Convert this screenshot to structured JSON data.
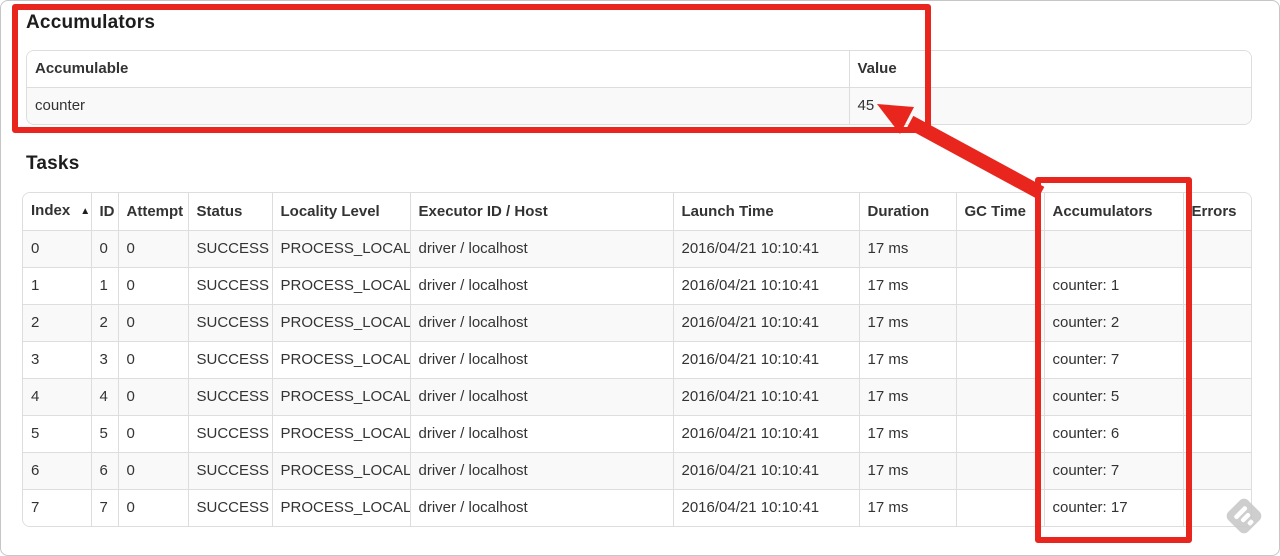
{
  "annotation": {
    "color": "#e8261d",
    "boxes": [
      "accumulators-summary",
      "accumulators-column"
    ],
    "arrow_target_value": "45"
  },
  "accumulators_section": {
    "title": "Accumulators",
    "table": {
      "headers": [
        "Accumulable",
        "Value"
      ],
      "rows": [
        [
          "counter",
          "45"
        ]
      ]
    }
  },
  "tasks_section": {
    "title": "Tasks",
    "table": {
      "headers": [
        "Index",
        "ID",
        "Attempt",
        "Status",
        "Locality Level",
        "Executor ID / Host",
        "Launch Time",
        "Duration",
        "GC Time",
        "Accumulators",
        "Errors"
      ],
      "sorted_column": "Index",
      "sort_icon": "▲",
      "rows": [
        [
          "0",
          "0",
          "0",
          "SUCCESS",
          "PROCESS_LOCAL",
          "driver / localhost",
          "2016/04/21 10:10:41",
          "17 ms",
          "",
          "",
          ""
        ],
        [
          "1",
          "1",
          "0",
          "SUCCESS",
          "PROCESS_LOCAL",
          "driver / localhost",
          "2016/04/21 10:10:41",
          "17 ms",
          "",
          "counter: 1",
          ""
        ],
        [
          "2",
          "2",
          "0",
          "SUCCESS",
          "PROCESS_LOCAL",
          "driver / localhost",
          "2016/04/21 10:10:41",
          "17 ms",
          "",
          "counter: 2",
          ""
        ],
        [
          "3",
          "3",
          "0",
          "SUCCESS",
          "PROCESS_LOCAL",
          "driver / localhost",
          "2016/04/21 10:10:41",
          "17 ms",
          "",
          "counter: 7",
          ""
        ],
        [
          "4",
          "4",
          "0",
          "SUCCESS",
          "PROCESS_LOCAL",
          "driver / localhost",
          "2016/04/21 10:10:41",
          "17 ms",
          "",
          "counter: 5",
          ""
        ],
        [
          "5",
          "5",
          "0",
          "SUCCESS",
          "PROCESS_LOCAL",
          "driver / localhost",
          "2016/04/21 10:10:41",
          "17 ms",
          "",
          "counter: 6",
          ""
        ],
        [
          "6",
          "6",
          "0",
          "SUCCESS",
          "PROCESS_LOCAL",
          "driver / localhost",
          "2016/04/21 10:10:41",
          "17 ms",
          "",
          "counter: 7",
          ""
        ],
        [
          "7",
          "7",
          "0",
          "SUCCESS",
          "PROCESS_LOCAL",
          "driver / localhost",
          "2016/04/21 10:10:41",
          "17 ms",
          "",
          "counter: 17",
          ""
        ]
      ]
    }
  },
  "watermark": {
    "icon": "feedly-logo"
  }
}
